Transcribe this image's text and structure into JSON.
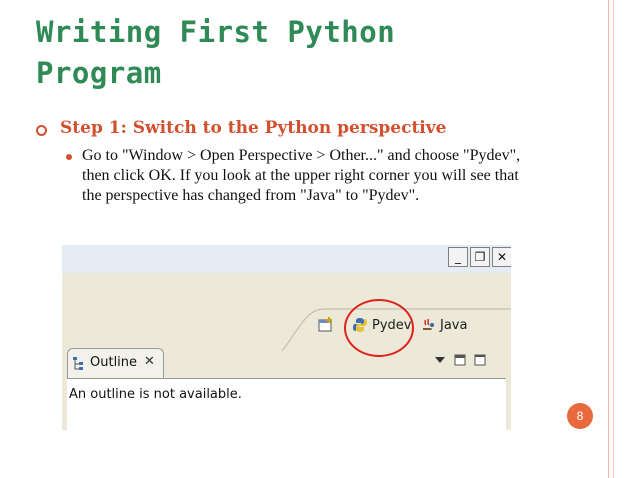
{
  "slide": {
    "title": "Writing First Python Program",
    "bullet_1": "Step 1: Switch to the Python perspective",
    "bullet_2": "Go to \"Window > Open Perspective > Other...\" and choose \"Pydev\", then click OK. If you look at the upper right corner you will see that the perspective has changed from \"Java\" to \"Pydev\".",
    "page_number": "8"
  },
  "screenshot": {
    "window_buttons": [
      "_",
      "❐",
      "✕"
    ],
    "perspectives": [
      {
        "label": "Pydev",
        "icon": "python-icon"
      },
      {
        "label": "Java",
        "icon": "java-icon"
      }
    ],
    "outline_tab": "Outline",
    "outline_close": "✕",
    "outline_message": "An outline is not available."
  },
  "colors": {
    "title": "#2f8a56",
    "accent": "#d3502f",
    "highlight_circle": "#e0201a",
    "badge": "#e8693c"
  }
}
